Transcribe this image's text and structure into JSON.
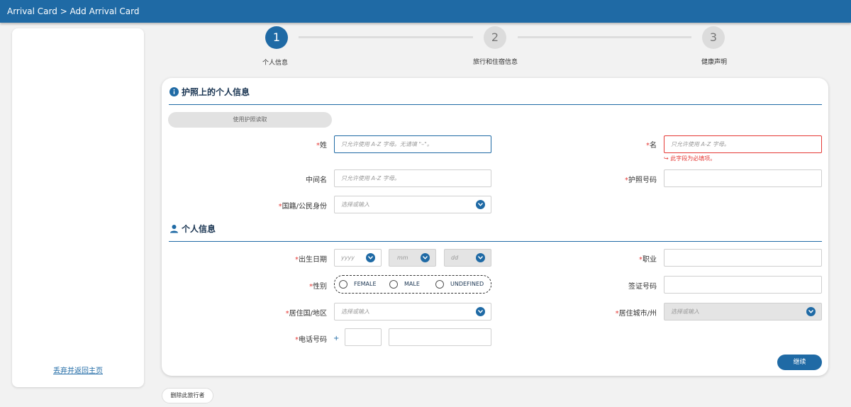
{
  "header": {
    "breadcrumb": "Arrival Card > Add Arrival Card"
  },
  "sidebar": {
    "back_link": "丢弃并返回主页"
  },
  "steps": [
    {
      "number": "1",
      "label": "个人信息",
      "state": "active"
    },
    {
      "number": "2",
      "label": "旅行和住宿信息",
      "state": "inactive"
    },
    {
      "number": "3",
      "label": "健康声明",
      "state": "inactive"
    }
  ],
  "passport_section": {
    "title": "护照上的个人信息",
    "icon": "info-icon",
    "read_passport_button": "使用护照读取",
    "fields": {
      "surname": {
        "label": "姓",
        "required": true,
        "placeholder": "只允许使用 A-Z 字母。无请填 \"–\"。",
        "state": "focused"
      },
      "given_name": {
        "label": "名",
        "required": true,
        "placeholder": "只允许使用 A-Z 字母。",
        "state": "error",
        "error": "此字段为必填项。"
      },
      "middle_name": {
        "label": "中间名",
        "required": false,
        "placeholder": "只允许使用 A-Z 字母。"
      },
      "passport_number": {
        "label": "护照号码",
        "required": true,
        "placeholder": ""
      },
      "nationality": {
        "label": "国籍/公民身份",
        "required": true,
        "placeholder": "选择或输入"
      }
    }
  },
  "personal_section": {
    "title": "个人信息",
    "icon": "person-icon",
    "fields": {
      "dob": {
        "label": "出生日期",
        "required": true,
        "year": "yyyy",
        "month": "mm",
        "day": "dd"
      },
      "occupation": {
        "label": "职业",
        "required": true
      },
      "gender": {
        "label": "性别",
        "required": true,
        "options": [
          "FEMALE",
          "MALE",
          "UNDEFINED"
        ]
      },
      "visa_number": {
        "label": "签证号码",
        "required": false
      },
      "residence_country": {
        "label": "居住国/地区",
        "required": true,
        "placeholder": "选择或输入"
      },
      "residence_city": {
        "label": "居住城市/州",
        "required": true,
        "placeholder": "选择或输入"
      },
      "phone": {
        "label": "电话号码",
        "required": true,
        "prefix": "+"
      }
    }
  },
  "buttons": {
    "continue": "继续",
    "delete_traveler": "删除此旅行者"
  },
  "colors": {
    "brand": "#1f6aa5",
    "error": "#e53935",
    "required_star": "#e53935"
  }
}
